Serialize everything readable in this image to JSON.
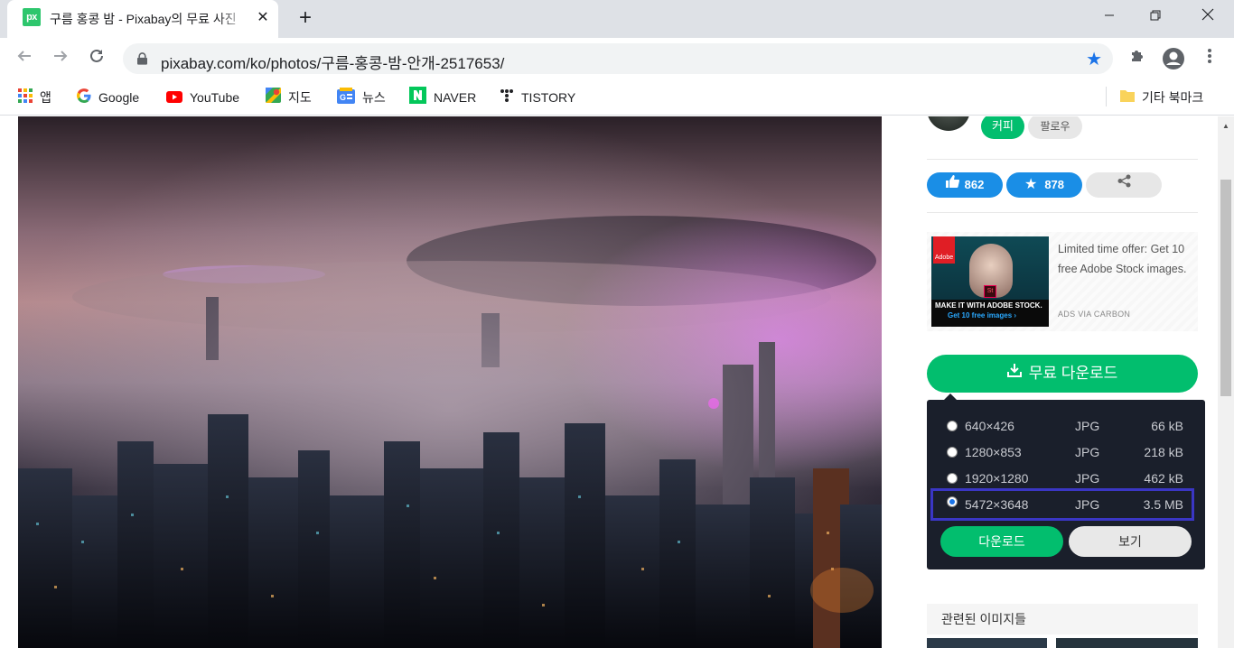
{
  "browser": {
    "tab": {
      "favicon": "px",
      "title": "구름 홍콩 밤 - Pixabay의 무료 사진",
      "close": "✕"
    },
    "new_tab": "+",
    "window": {
      "minimize": "—",
      "maximize": "❐",
      "close": "✕"
    },
    "url": "pixabay.com/ko/photos/구름-홍콩-밤-안개-2517653/",
    "bookmarks": [
      {
        "label": "앱",
        "icon": "apps-grid-icon"
      },
      {
        "label": "Google",
        "icon": "google-icon"
      },
      {
        "label": "YouTube",
        "icon": "youtube-icon"
      },
      {
        "label": "지도",
        "icon": "maps-icon"
      },
      {
        "label": "뉴스",
        "icon": "news-icon"
      },
      {
        "label": "NAVER",
        "icon": "naver-icon"
      },
      {
        "label": "TISTORY",
        "icon": "tistory-icon"
      }
    ],
    "other_bookmarks": "기타 북마크"
  },
  "sidebar": {
    "coffee_label": "커피",
    "follow_label": "팔로우",
    "likes": "862",
    "favorites": "878",
    "ad": {
      "text": "Limited time offer: Get 10 free Adobe Stock images.",
      "via": "ADS VIA CARBON",
      "img_headline": "MAKE IT WITH ADOBE STOCK.",
      "img_sub": "Get 10 free images ›",
      "brand": "Adobe",
      "st": "St"
    },
    "download_label": "무료 다운로드",
    "download_options": [
      {
        "size": "640×426",
        "format": "JPG",
        "filesize": "66 kB",
        "selected": false
      },
      {
        "size": "1280×853",
        "format": "JPG",
        "filesize": "218 kB",
        "selected": false
      },
      {
        "size": "1920×1280",
        "format": "JPG",
        "filesize": "462 kB",
        "selected": false
      },
      {
        "size": "5472×3648",
        "format": "JPG",
        "filesize": "3.5 MB",
        "selected": true
      }
    ],
    "dd_download": "다운로드",
    "dd_view": "보기",
    "related_title": "관련된 이미지들"
  },
  "colors": {
    "accent": "#02be6e",
    "blue": "#1a73e8",
    "dropdown_bg": "#1a1f2b",
    "highlight": "#3a36c4"
  }
}
